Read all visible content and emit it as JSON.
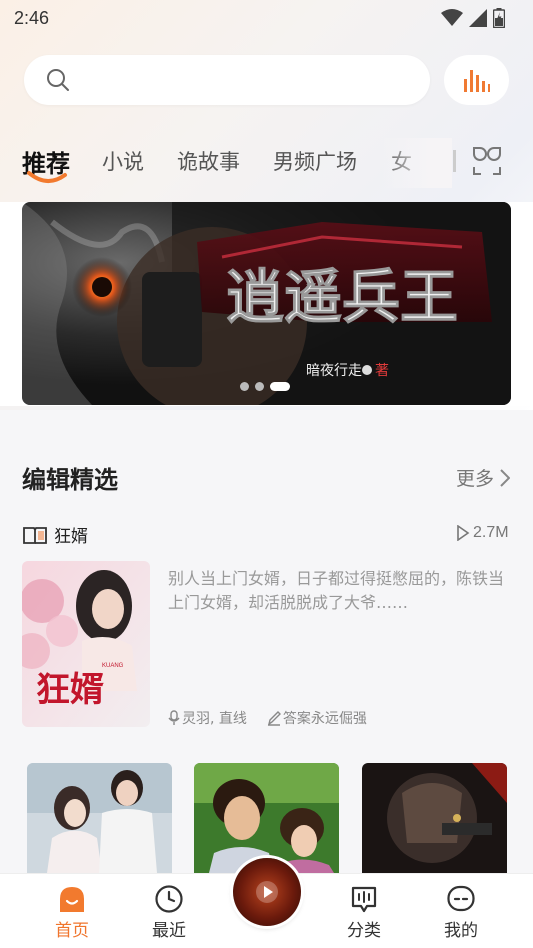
{
  "status_bar": {
    "time": "2:46"
  },
  "search": {
    "placeholder": ""
  },
  "tabs": [
    {
      "label": "推荐",
      "active": true
    },
    {
      "label": "小说"
    },
    {
      "label": "诡故事"
    },
    {
      "label": "男频广场"
    },
    {
      "label": "女"
    }
  ],
  "banner": {
    "title_text": "逍遥兵王",
    "author_text": "暗夜行走",
    "author_suffix": "著",
    "dots": 3,
    "active_dot": 2
  },
  "editor_picks": {
    "title": "编辑精选",
    "more_label": "更多",
    "featured": {
      "title": "狂婿",
      "plays": "2.7M",
      "description": "别人当上门女婿，日子都过得挺憋屈的，陈铁当上门女婿，却活脱脱成了大爷……",
      "narrator": "灵羽, 直线",
      "author": "答案永远倔强",
      "cover_title": "狂婿",
      "cover_sub": "KUANG"
    }
  },
  "bottom_nav": {
    "items": [
      {
        "label": "首页",
        "active": true,
        "icon": "home-icon"
      },
      {
        "label": "最近",
        "icon": "clock-icon"
      },
      {
        "label": "分类",
        "icon": "category-icon"
      },
      {
        "label": "我的",
        "icon": "profile-icon"
      }
    ]
  },
  "colors": {
    "accent": "#f0752d",
    "background": "#f6f6f8"
  }
}
